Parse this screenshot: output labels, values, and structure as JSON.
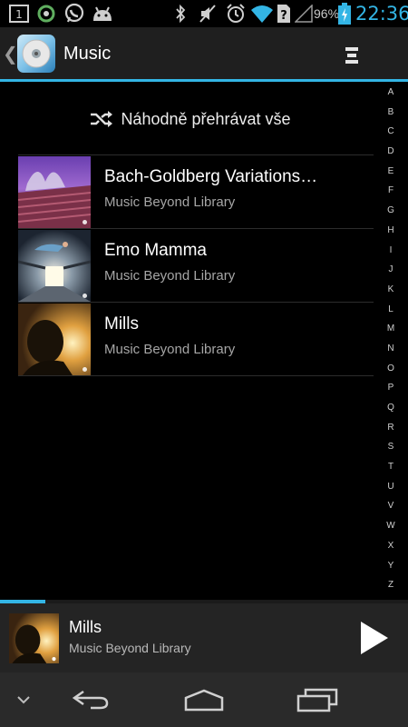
{
  "status_bar": {
    "notification_count": "1",
    "battery_percent": "96%",
    "time": "22:36",
    "icons": [
      "notification-count-icon",
      "sync-icon",
      "whatsapp-icon",
      "android-icon",
      "bluetooth-icon",
      "mute-icon",
      "alarm-icon",
      "wifi-icon",
      "no-sim-icon",
      "signal-icon",
      "battery-icon"
    ]
  },
  "action_bar": {
    "title": "Music",
    "icons": [
      "back-chevron-icon",
      "music-cd-icon",
      "overflow-menu-icon"
    ]
  },
  "shuffle": {
    "label": "Náhodně přehrávat vše",
    "icon": "shuffle-icon"
  },
  "songs": [
    {
      "title": "Bach-Goldberg Variations…",
      "artist": "Music Beyond Library"
    },
    {
      "title": "Emo Mamma",
      "artist": "Music Beyond Library"
    },
    {
      "title": "Mills",
      "artist": "Music Beyond Library"
    }
  ],
  "alphabet": [
    "A",
    "B",
    "C",
    "D",
    "E",
    "F",
    "G",
    "H",
    "I",
    "J",
    "K",
    "L",
    "M",
    "N",
    "O",
    "P",
    "Q",
    "R",
    "S",
    "T",
    "U",
    "V",
    "W",
    "X",
    "Y",
    "Z"
  ],
  "now_playing": {
    "title": "Mills",
    "artist": "Music Beyond Library",
    "progress_fraction": 0.11,
    "icon": "play-icon"
  },
  "nav_bar": {
    "icons": [
      "hide-keyboard-icon",
      "back-icon",
      "home-icon",
      "recents-icon"
    ]
  },
  "colors": {
    "accent": "#33b5e5",
    "background": "#000000",
    "action_bar": "#1f1f1f",
    "now_playing_bar": "#242424",
    "nav_bar": "#2a2a2a"
  }
}
